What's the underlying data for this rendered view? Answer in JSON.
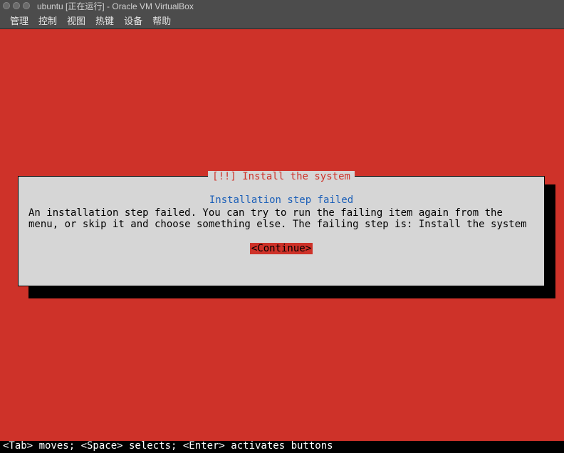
{
  "window": {
    "title": "ubuntu [正在运行] - Oracle VM VirtualBox"
  },
  "menu": {
    "items": [
      "管理",
      "控制",
      "视图",
      "热键",
      "设备",
      "帮助"
    ]
  },
  "dialog": {
    "title": "[!!] Install the system",
    "subtitle": "Installation step failed",
    "message": "An installation step failed. You can try to run the failing item again from the menu, or skip it and choose something else. The failing step is: Install the system",
    "continue_label": "<Continue>"
  },
  "footer": {
    "hint": "<Tab> moves; <Space> selects; <Enter> activates buttons"
  }
}
